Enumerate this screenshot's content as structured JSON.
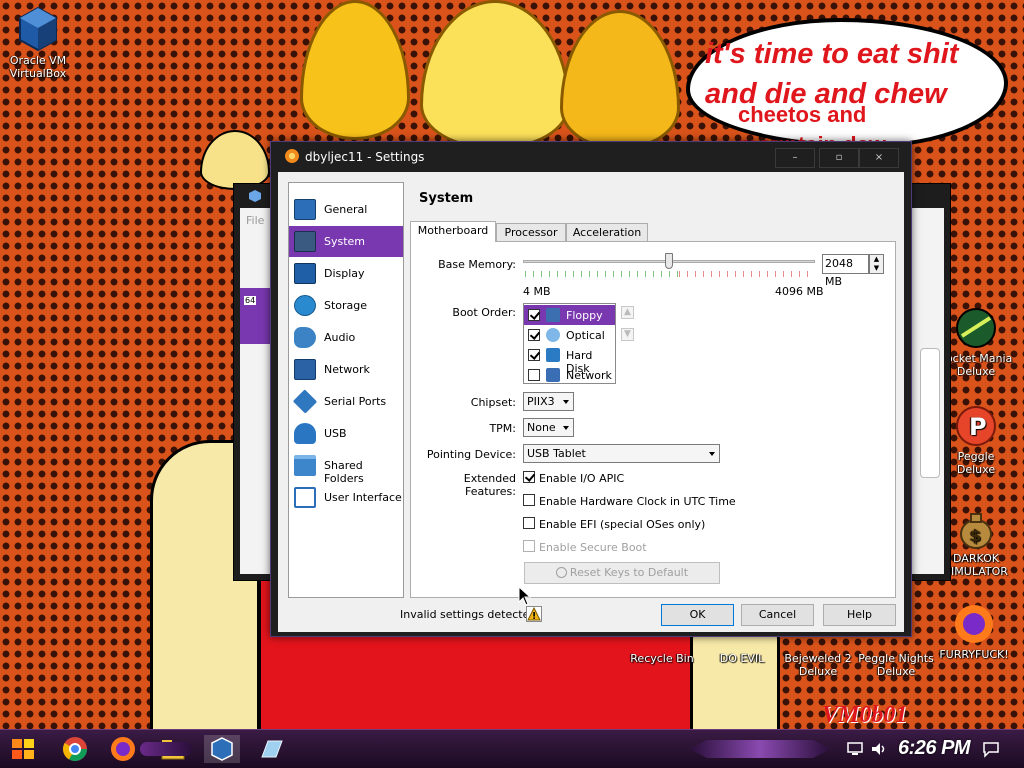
{
  "wallpaper": {
    "speech_main": "it's time to eat shit\nand die and chew",
    "speech_sub": "cheetos and\nmountain dew",
    "watermark": "VM0b01"
  },
  "desktop_icons": {
    "virtualbox": "Oracle VM\nVirtualBox",
    "pocket_mania": "Pocket Mania\nDeluxe",
    "peggle": "Peggle Deluxe",
    "darkok": "DARKOK\nSIMULATOR",
    "recycle_bin": "Recycle Bin",
    "do_evil": "DO EVIL",
    "bejeweled": "Bejeweled 2\nDeluxe",
    "peggle_nights": "Peggle Nights\nDeluxe",
    "furryfuck": "FURRYFUCK!"
  },
  "bg_window": {
    "menu": "File",
    "badge": "64"
  },
  "dialog": {
    "title": "dbyljec11 - Settings",
    "controls": {
      "minimize": "–",
      "maximize": "▫",
      "close": "×"
    }
  },
  "sidebar": {
    "items": [
      {
        "label": "General",
        "icon": "monitor-icon",
        "color": "#2c6fb8"
      },
      {
        "label": "System",
        "icon": "chip-icon",
        "color": "#3b5a82"
      },
      {
        "label": "Display",
        "icon": "display-icon",
        "color": "#1f5fa8"
      },
      {
        "label": "Storage",
        "icon": "disk-icon",
        "color": "#2a8ad0"
      },
      {
        "label": "Audio",
        "icon": "speaker-icon",
        "color": "#3b83c4"
      },
      {
        "label": "Network",
        "icon": "network-icon",
        "color": "#2b62a6"
      },
      {
        "label": "Serial Ports",
        "icon": "serial-icon",
        "color": "#2f78c0"
      },
      {
        "label": "USB",
        "icon": "usb-icon",
        "color": "#2a76c2"
      },
      {
        "label": "Shared Folders",
        "icon": "folder-icon",
        "color": "#3d86cc"
      },
      {
        "label": "User Interface",
        "icon": "ui-icon",
        "color": "#2c6fb8"
      }
    ],
    "selected": "System"
  },
  "system": {
    "section_title": "System",
    "tabs": [
      "Motherboard",
      "Processor",
      "Acceleration"
    ],
    "active_tab": "Motherboard",
    "base_memory": {
      "label": "Base Memory:",
      "value": "2048 MB",
      "min_label": "4 MB",
      "max_label": "4096 MB",
      "level": 0.5
    },
    "boot_order": {
      "label": "Boot Order:",
      "items": [
        {
          "label": "Floppy",
          "checked": true,
          "selected": true,
          "icon": "floppy-icon"
        },
        {
          "label": "Optical",
          "checked": true,
          "selected": false,
          "icon": "optical-icon"
        },
        {
          "label": "Hard Disk",
          "checked": true,
          "selected": false,
          "icon": "harddisk-icon"
        },
        {
          "label": "Network",
          "checked": false,
          "selected": false,
          "icon": "network-icon"
        }
      ]
    },
    "chipset": {
      "label": "Chipset:",
      "value": "PIIX3"
    },
    "tpm": {
      "label": "TPM:",
      "value": "None"
    },
    "pointing_device": {
      "label": "Pointing Device:",
      "value": "USB Tablet"
    },
    "extended_features": {
      "label": "Extended Features:",
      "options": [
        {
          "label": "Enable I/O APIC",
          "checked": true,
          "enabled": true
        },
        {
          "label": "Enable Hardware Clock in UTC Time",
          "checked": false,
          "enabled": true
        },
        {
          "label": "Enable EFI (special OSes only)",
          "checked": false,
          "enabled": true
        },
        {
          "label": "Enable Secure Boot",
          "checked": false,
          "enabled": false
        }
      ]
    },
    "reset_keys_button": "Reset Keys to Default"
  },
  "footer": {
    "status": "Invalid settings detected",
    "ok": "OK",
    "cancel": "Cancel",
    "help": "Help"
  },
  "taskbar": {
    "clock": "6:26 PM"
  }
}
